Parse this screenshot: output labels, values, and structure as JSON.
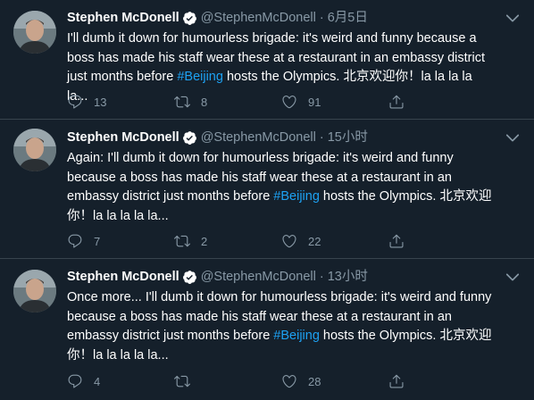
{
  "colors": {
    "background": "#15202b",
    "divider": "#38444d",
    "secondary_text": "#8899a6",
    "link": "#1da1f2",
    "verified": "#ffffff"
  },
  "icons": {
    "verified": "verified-badge-icon",
    "more": "chevron-down-icon",
    "reply": "reply-icon",
    "retweet": "retweet-icon",
    "like": "heart-icon",
    "share": "share-icon"
  },
  "tweets": [
    {
      "name": "Stephen McDonell",
      "handle": "@StephenMcDonell",
      "separator": "·",
      "time": "6月5日",
      "text_before": "I'll dumb it down for humourless brigade: it's weird and funny because a boss has made his staff wear these at a restaurant in an embassy district just months before ",
      "hashtag": "#Beijing",
      "text_after": " hosts the Olympics. 北京欢迎你！la la la la la...",
      "replies": "13",
      "retweets": "8",
      "likes": "91"
    },
    {
      "name": "Stephen McDonell",
      "handle": "@StephenMcDonell",
      "separator": "·",
      "time": "15小时",
      "text_before": "Again: I'll dumb it down for humourless brigade: it's weird and funny because a boss has made his staff wear these at a restaurant in an embassy district just months before ",
      "hashtag": "#Beijing",
      "text_after": " hosts the Olympics. 北京欢迎你！la la la la la...",
      "replies": "7",
      "retweets": "2",
      "likes": "22"
    },
    {
      "name": "Stephen McDonell",
      "handle": "@StephenMcDonell",
      "separator": "·",
      "time": "13小时",
      "text_before": "Once more... I'll dumb it down for humourless brigade: it's weird and funny because a boss has made his staff wear these at a restaurant in an embassy district just months before ",
      "hashtag": "#Beijing",
      "text_after": " hosts the Olympics. 北京欢迎你！la la la la la...",
      "replies": "4",
      "retweets": "",
      "likes": "28"
    }
  ]
}
